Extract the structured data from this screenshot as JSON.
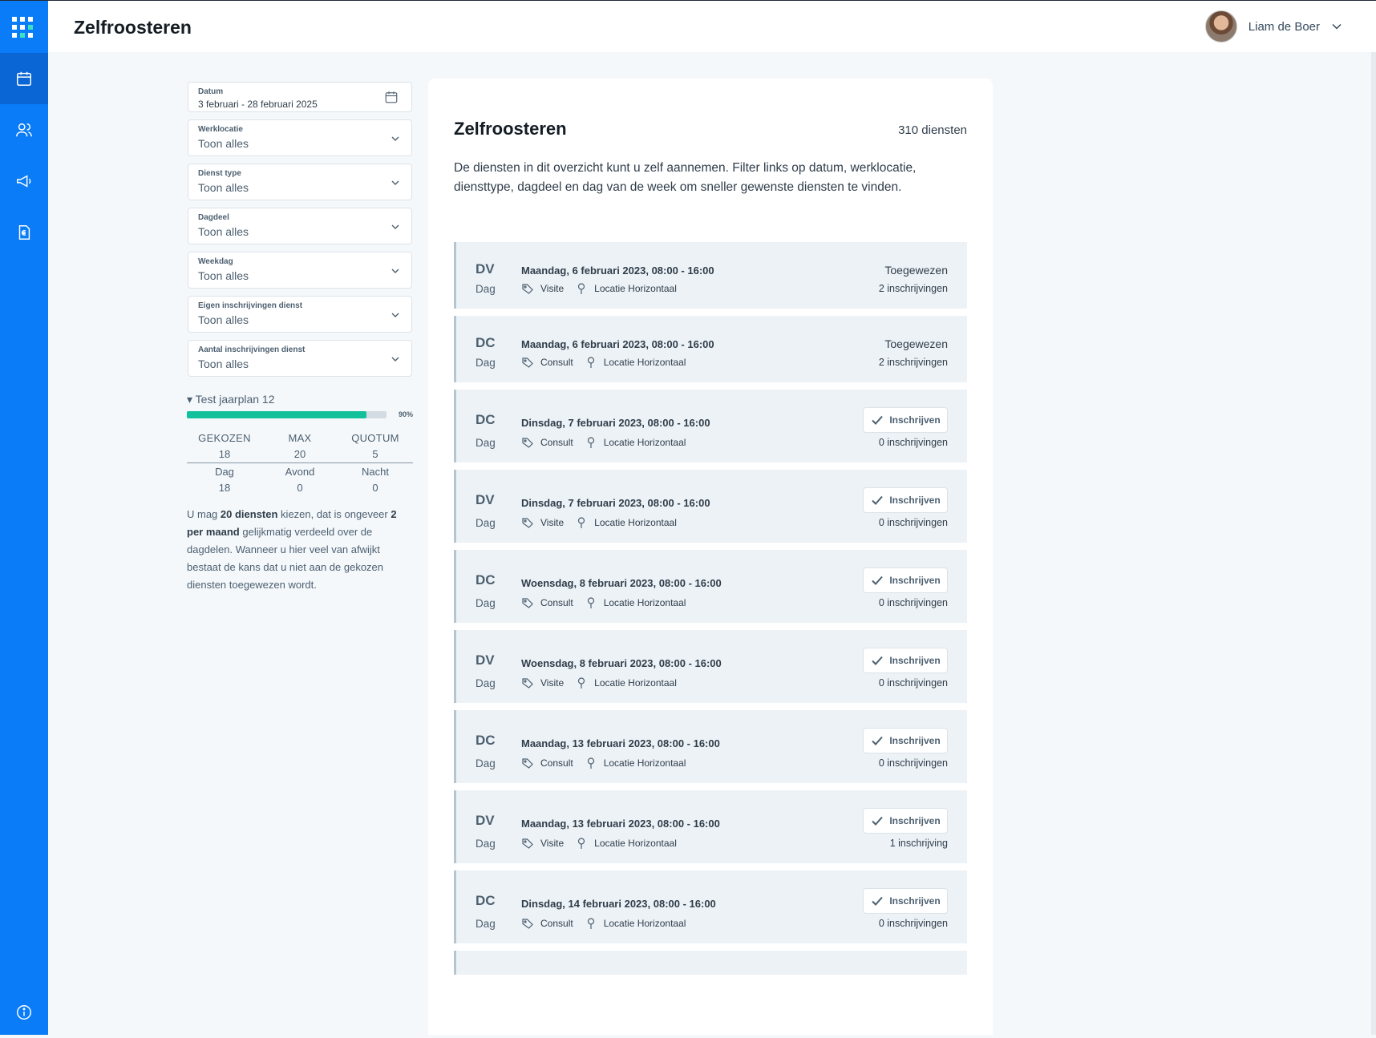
{
  "header": {
    "title": "Zelfroosteren",
    "user_name": "Liam de Boer"
  },
  "filters": [
    {
      "label": "Datum",
      "value": "3 februari - 28 februari 2025"
    },
    {
      "label": "Werklocatie",
      "value": "Toon alles"
    },
    {
      "label": "Dienst type",
      "value": "Toon alles"
    },
    {
      "label": "Dagdeel",
      "value": "Toon alles"
    },
    {
      "label": "Weekdag",
      "value": "Toon alles"
    },
    {
      "label": "Eigen inschrijvingen dienst",
      "value": "Toon alles"
    },
    {
      "label": "Aantal inschrijvingen dienst",
      "value": "Toon alles"
    }
  ],
  "plan": {
    "title": "▾ Test jaarplan 12",
    "progress": 0.9,
    "progress_label": "90%",
    "headers": [
      "GEKOZEN",
      "MAX",
      "QUOTUM"
    ],
    "values": [
      "18",
      "20",
      "5"
    ],
    "dayparts": [
      "Dag",
      "Avond",
      "Nacht"
    ],
    "daypart_values": [
      "18",
      "0",
      "0"
    ],
    "text_1": "U mag ",
    "text_bold_1": "20 diensten",
    "text_2": " kiezen, dat is ongeveer ",
    "text_bold_2": "2 per maand",
    "text_3": " gelijkmatig verdeeld over de dagdelen. Wanneer u hier veel van afwijkt bestaat de kans dat u niet aan de gekozen diensten toegewezen wordt."
  },
  "main": {
    "title": "Zelfroosteren",
    "count": "310 diensten",
    "description": "De diensten in dit overzicht kunt u zelf aannemen. Filter links op datum, werklocatie, diensttype, dagdeel en dag van de week om sneller gewenste diensten te vinden.",
    "button_label": "Inschrijven",
    "shifts": [
      {
        "code": "DV",
        "daypart": "Dag",
        "date": "Maandag, 6 februari 2023, 08:00 - 16:00",
        "type": "Visite",
        "location": "Locatie Horizontaal",
        "status": "Toegewezen",
        "registrations": "2 inschrijvingen"
      },
      {
        "code": "DC",
        "daypart": "Dag",
        "date": "Maandag, 6 februari 2023, 08:00 - 16:00",
        "type": "Consult",
        "location": "Locatie Horizontaal",
        "status": "Toegewezen",
        "registrations": "2 inschrijvingen"
      },
      {
        "code": "DC",
        "daypart": "Dag",
        "date": "Dinsdag, 7 februari 2023, 08:00 - 16:00",
        "type": "Consult",
        "location": "Locatie Horizontaal",
        "status": "",
        "registrations": "0 inschrijvingen"
      },
      {
        "code": "DV",
        "daypart": "Dag",
        "date": "Dinsdag, 7 februari 2023, 08:00 - 16:00",
        "type": "Visite",
        "location": "Locatie Horizontaal",
        "status": "",
        "registrations": "0 inschrijvingen"
      },
      {
        "code": "DC",
        "daypart": "Dag",
        "date": "Woensdag, 8 februari 2023, 08:00 - 16:00",
        "type": "Consult",
        "location": "Locatie Horizontaal",
        "status": "",
        "registrations": "0 inschrijvingen"
      },
      {
        "code": "DV",
        "daypart": "Dag",
        "date": "Woensdag, 8 februari 2023, 08:00 - 16:00",
        "type": "Visite",
        "location": "Locatie Horizontaal",
        "status": "",
        "registrations": "0 inschrijvingen"
      },
      {
        "code": "DC",
        "daypart": "Dag",
        "date": "Maandag, 13 februari 2023, 08:00 - 16:00",
        "type": "Consult",
        "location": "Locatie Horizontaal",
        "status": "",
        "registrations": "0 inschrijvingen"
      },
      {
        "code": "DV",
        "daypart": "Dag",
        "date": "Maandag, 13 februari 2023, 08:00 - 16:00",
        "type": "Visite",
        "location": "Locatie Horizontaal",
        "status": "",
        "registrations": "1 inschrijving"
      },
      {
        "code": "DC",
        "daypart": "Dag",
        "date": "Dinsdag, 14 februari 2023, 08:00 - 16:00",
        "type": "Consult",
        "location": "Locatie Horizontaal",
        "status": "",
        "registrations": "0 inschrijvingen"
      }
    ]
  },
  "colors": {
    "sidebar": "#0a7cf8",
    "progress": "#12c19b",
    "card_row": "#edf2f6"
  },
  "icons": [
    "apps-grid-icon",
    "calendar-icon",
    "users-icon",
    "megaphone-icon",
    "invoice-icon",
    "info-icon",
    "chevron-down-icon",
    "tag-icon",
    "location-pin-icon",
    "check-icon"
  ]
}
